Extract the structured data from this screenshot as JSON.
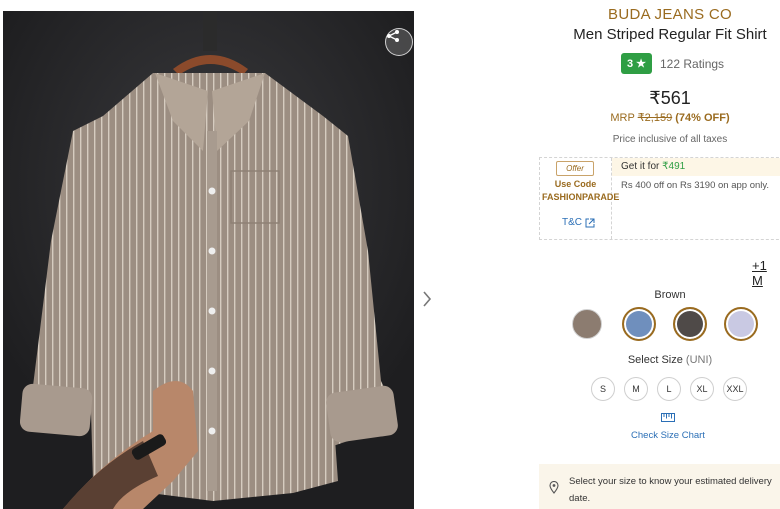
{
  "product": {
    "brand": "BUDA JEANS CO",
    "title": "Men Striped Regular Fit Shirt",
    "rating": "3",
    "rating_count": "122 Ratings",
    "price": "₹561",
    "mrp_label": "MRP",
    "mrp": "₹2,159",
    "discount": "(74% OFF)",
    "tax_note": "Price inclusive of all taxes"
  },
  "offer": {
    "tag": "Offer",
    "code_label": "Use Code FASHIONPARADE",
    "tc": "T&C",
    "get_it_prefix": "Get it for",
    "get_it_price": "₹491",
    "description": "Rs 400 off on Rs 3190 on app only."
  },
  "more_colors": "+1 M",
  "colors": {
    "label": "Brown",
    "swatches": [
      {
        "name": "brown",
        "color": "#8c7c70"
      },
      {
        "name": "blue",
        "color": "#6f8fbd"
      },
      {
        "name": "charcoal",
        "color": "#4f4a48"
      },
      {
        "name": "lavender",
        "color": "#c9c9e3"
      }
    ]
  },
  "sizes": {
    "label": "Select Size",
    "unit": "(UNI)",
    "options": [
      "S",
      "M",
      "L",
      "XL",
      "XXL"
    ]
  },
  "size_chart": "Check Size Chart",
  "delivery": "Select your size to know your estimated delivery date.",
  "icons": {
    "share": "share-icon",
    "next": "chevron-right-icon",
    "star": "star-icon",
    "external": "external-link-icon",
    "ruler": "ruler-icon",
    "pin": "location-pin-icon"
  },
  "theme": {
    "accent": "#9a6b1f",
    "rating_green": "#2f9e44",
    "link_blue": "#2b6fb6"
  }
}
